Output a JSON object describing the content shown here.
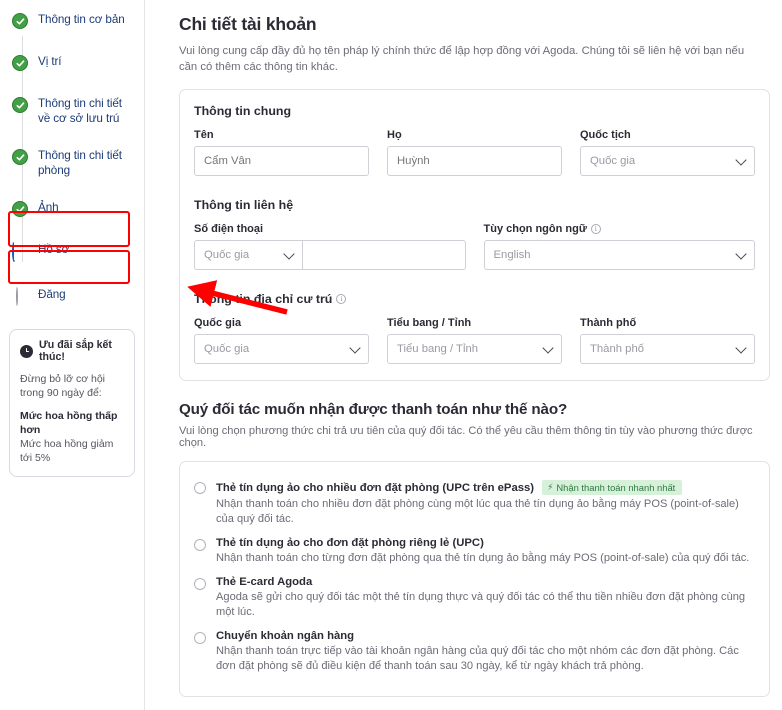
{
  "sidebar": {
    "steps": [
      {
        "label": "Thông tin cơ bản",
        "state": "done"
      },
      {
        "label": "Vị trí",
        "state": "done"
      },
      {
        "label": "Thông tin chi tiết về cơ sở lưu trú",
        "state": "done"
      },
      {
        "label": "Thông tin chi tiết phòng",
        "state": "done"
      },
      {
        "label": "Ảnh",
        "state": "done"
      },
      {
        "label": "Hồ sơ",
        "state": "current"
      },
      {
        "label": "Đăng",
        "state": "pending"
      }
    ],
    "promo": {
      "title": "Ưu đãi sắp kết thúc!",
      "line1": "Đừng bỏ lỡ cơ hội trong 90 ngày để:",
      "strong": "Mức hoa hồng thấp hơn",
      "line2": "Mức hoa hồng giảm tới 5%"
    }
  },
  "header": {
    "title": "Chi tiết tài khoản",
    "subtitle": "Vui lòng cung cấp đầy đủ họ tên pháp lý chính thức để lập hợp đồng với Agoda. Chúng tôi sẽ liên hệ với bạn nếu cần có thêm các thông tin khác."
  },
  "general": {
    "section_title": "Thông tin chung",
    "first_name_label": "Tên",
    "first_name_placeholder": "Cẩm Vân",
    "last_name_label": "Họ",
    "last_name_placeholder": "Huỳnh",
    "nationality_label": "Quốc tịch",
    "nationality_value": "Quốc gia"
  },
  "contact": {
    "section_title": "Thông tin liên hệ",
    "phone_label": "Số điện thoại",
    "phone_country_value": "Quốc gia",
    "phone_number_value": "",
    "language_label": "Tùy chọn ngôn ngữ",
    "language_value": "English"
  },
  "residence": {
    "section_title": "Thông tin địa chỉ cư trú",
    "country_label": "Quốc gia",
    "country_value": "Quốc gia",
    "state_label": "Tiểu bang / Tỉnh",
    "state_value": "Tiểu bang / Tỉnh",
    "city_label": "Thành phố",
    "city_value": "Thành phố"
  },
  "payment": {
    "title": "Quý đối tác muốn nhận được thanh toán như thế nào?",
    "subtitle": "Vui lòng chọn phương thức chi trả ưu tiên của quý đối tác. Có thể yêu cầu thêm thông tin tùy vào phương thức được chọn.",
    "badge_label": "Nhận thanh toán nhanh nhất",
    "options": [
      {
        "title": "Thẻ tín dụng ảo cho nhiều đơn đặt phòng (UPC trên ePass)",
        "desc": "Nhận thanh toán cho nhiều đơn đặt phòng cùng một lúc qua thẻ tín dụng ảo bằng máy POS (point-of-sale) của quý đối tác.",
        "badge": true
      },
      {
        "title": "Thẻ tín dụng ảo cho đơn đặt phòng riêng lẻ (UPC)",
        "desc": "Nhận thanh toán cho từng đơn đặt phòng qua thẻ tín dụng ảo bằng máy POS (point-of-sale) của quý đối tác.",
        "badge": false
      },
      {
        "title": "Thẻ E-card Agoda",
        "desc": "Agoda sẽ gửi cho quý đối tác một thẻ tín dụng thực và quý đối tác có thể thu tiền nhiều đơn đặt phòng cùng một lúc.",
        "badge": false
      },
      {
        "title": "Chuyển khoản ngân hàng",
        "desc": "Nhận thanh toán trực tiếp vào tài khoản ngân hàng của quý đối tác cho một nhóm các đơn đặt phòng. Các đơn đặt phòng sẽ đủ điều kiện để thanh toán sau 30 ngày, kể từ ngày khách trả phòng.",
        "badge": false
      }
    ]
  },
  "colors": {
    "accent_green": "#43a047",
    "link_blue": "#1d3c77",
    "spinner_blue": "#0a5ebf",
    "annotation_red": "#ff0000",
    "badge_bg": "#d6f0da",
    "badge_text": "#2f7a3f"
  }
}
